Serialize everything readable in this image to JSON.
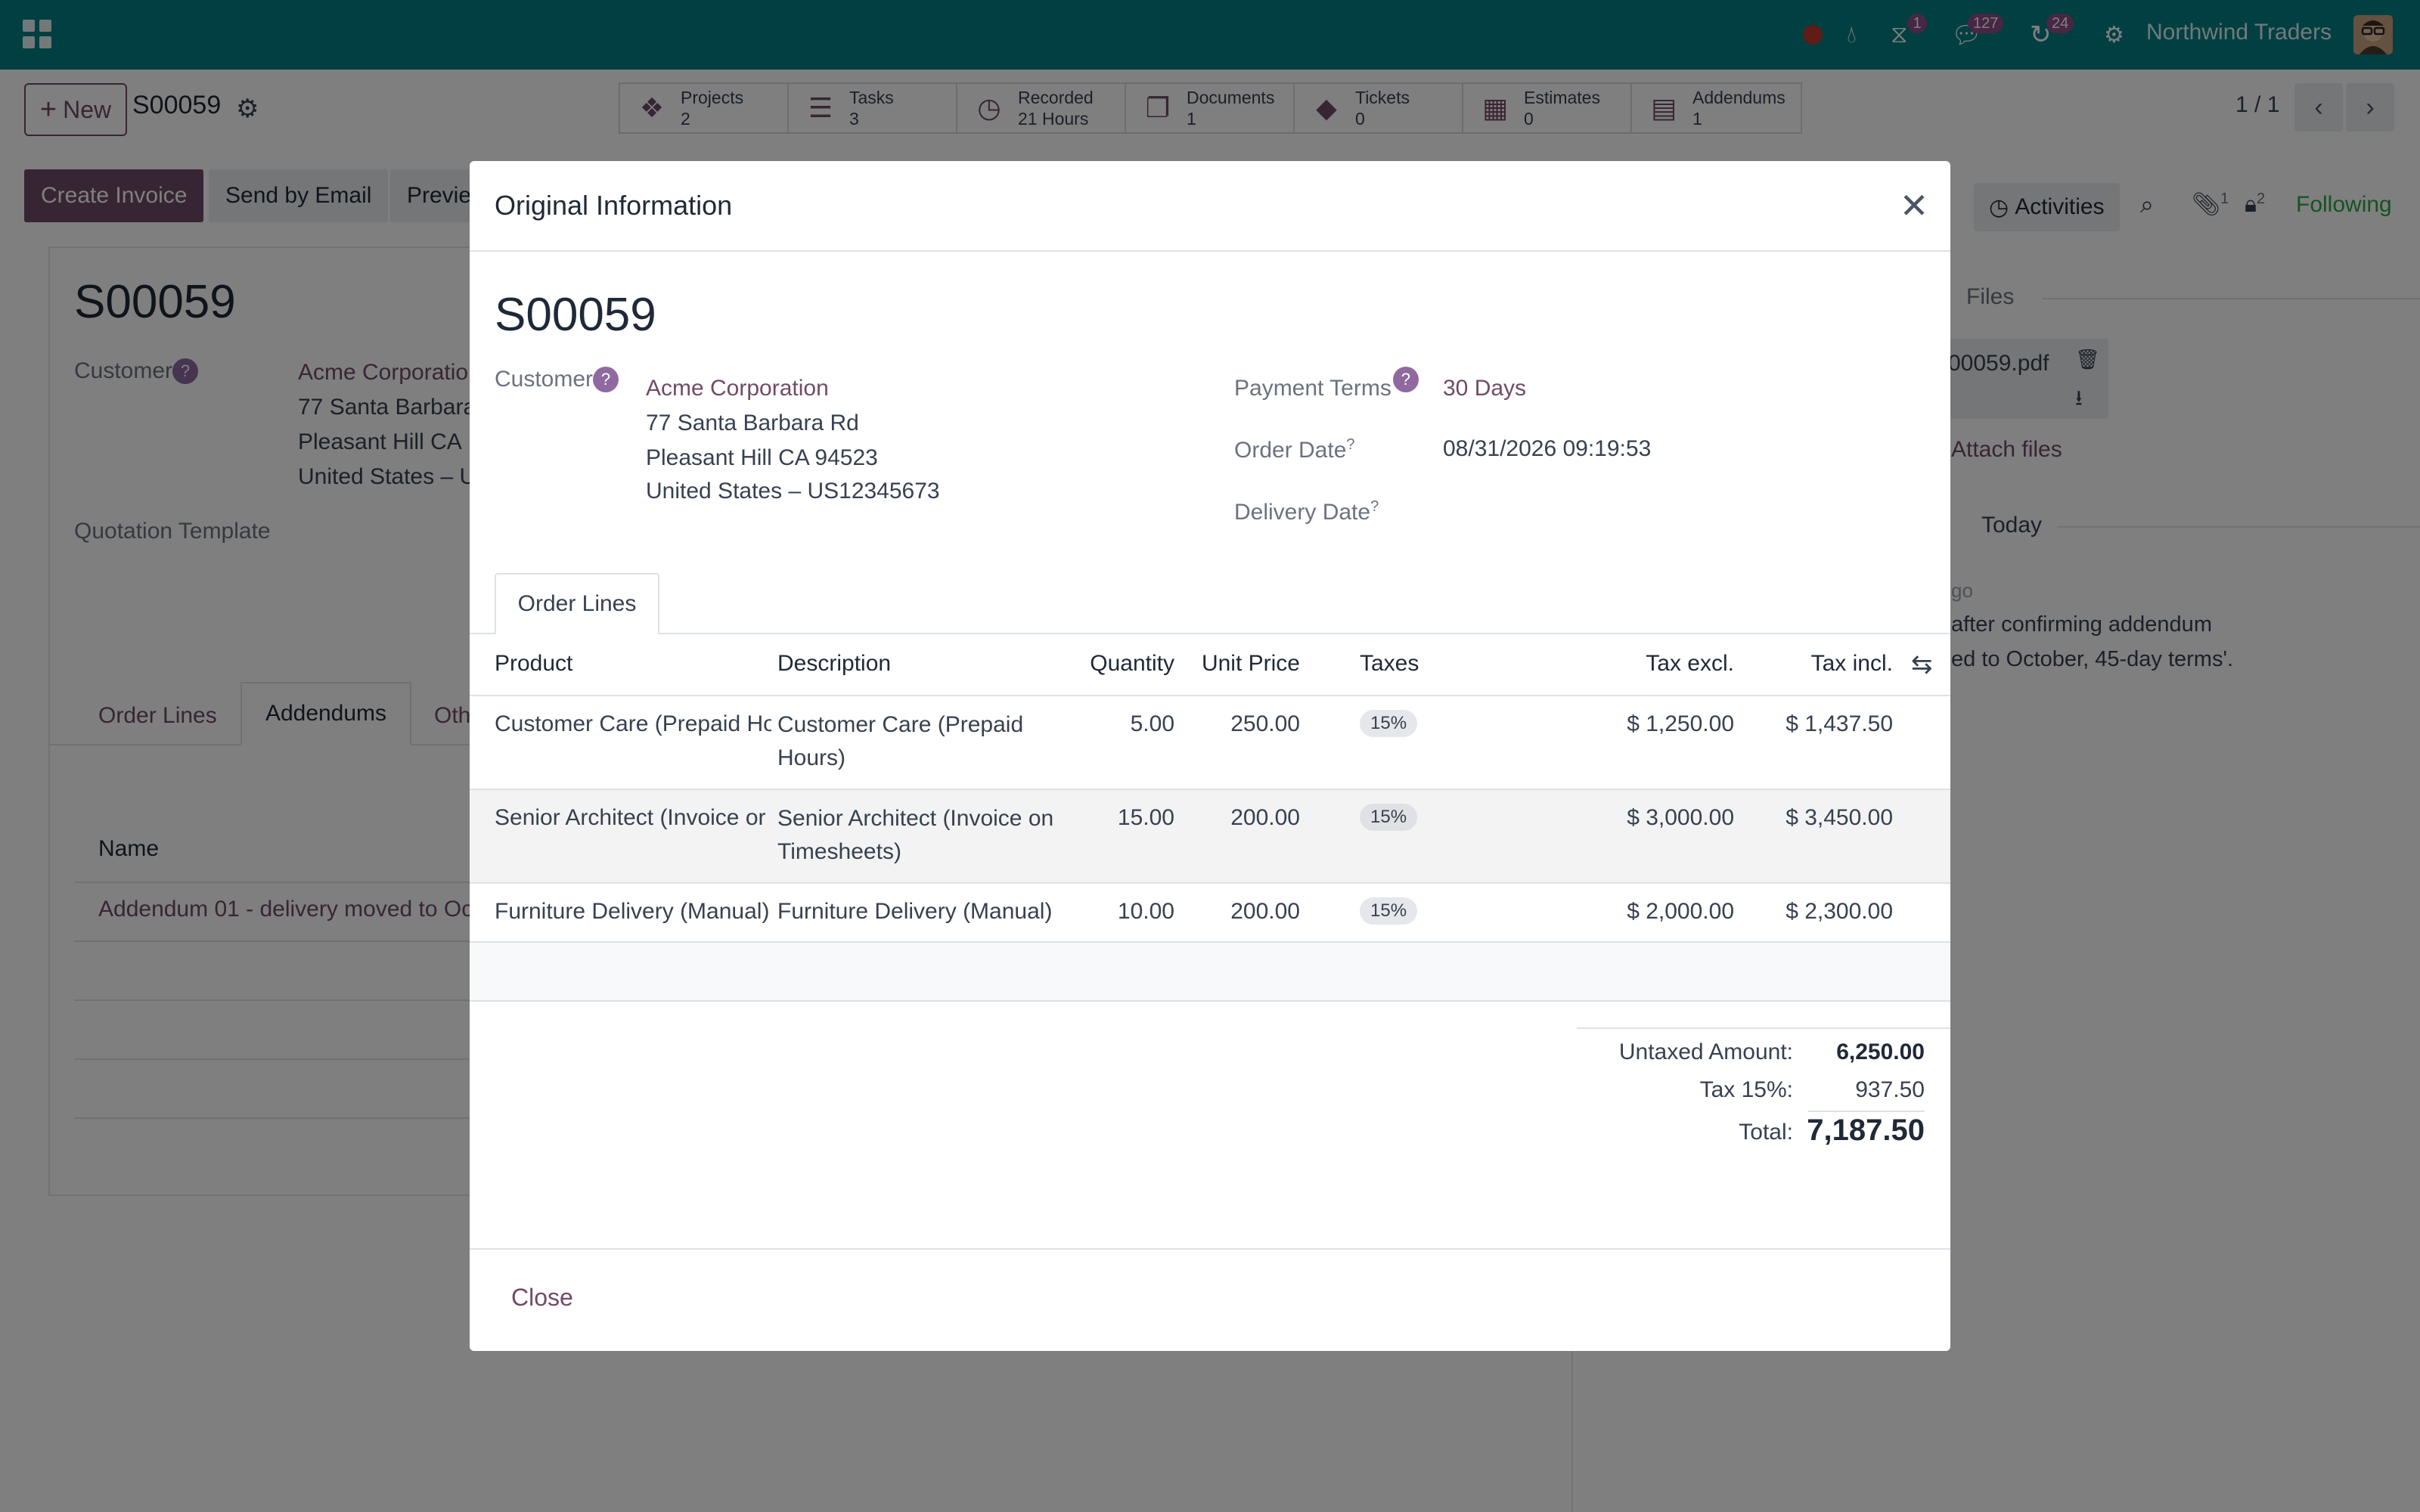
{
  "topbar": {
    "company": "Northwind Traders",
    "badges": {
      "activities": "1",
      "messages": "127",
      "updates": "24"
    }
  },
  "control": {
    "new_label": "New",
    "record": "S00059",
    "pager": "1 / 1",
    "smart_buttons": [
      {
        "label": "Projects",
        "value": "2",
        "icon": "puzzle-icon"
      },
      {
        "label": "Tasks",
        "value": "3",
        "icon": "tasks-icon"
      },
      {
        "label": "Recorded",
        "value": "21 Hours",
        "icon": "clock-icon"
      },
      {
        "label": "Documents",
        "value": "1",
        "icon": "documents-icon"
      },
      {
        "label": "Tickets",
        "value": "0",
        "icon": "ticket-icon"
      },
      {
        "label": "Estimates",
        "value": "0",
        "icon": "table-icon"
      },
      {
        "label": "Addendums",
        "value": "1",
        "icon": "book-icon"
      }
    ]
  },
  "actions": {
    "create_invoice": "Create Invoice",
    "send_email": "Send by Email",
    "preview": "Previe"
  },
  "form": {
    "name": "S00059",
    "customer_label": "Customer",
    "customer_name": "Acme Corporatio",
    "address1": "77 Santa Barbara",
    "address2": "Pleasant Hill CA",
    "address3": "United States – U",
    "quotation_template": "Quotation Template",
    "tabs": [
      "Order Lines",
      "Addendums",
      "Oth"
    ],
    "list_header": "Name",
    "addendum_row": "Addendum 01 - delivery moved to Oct"
  },
  "chatter": {
    "activities": "Activities",
    "following": "Following",
    "attach_count": "1",
    "follower_count": "2",
    "files_heading": "Files",
    "file_name": "00059.pdf",
    "attach_files": "Attach files",
    "today": "Today",
    "msg_time": "go",
    "msg_line1": "after confirming addendum",
    "msg_line2": "ed to October, 45-day terms'."
  },
  "modal": {
    "title": "Original Information",
    "so_name": "S00059",
    "customer_label": "Customer",
    "customer_name": "Acme Corporation",
    "address1": "77 Santa Barbara Rd",
    "address2": "Pleasant Hill CA 94523",
    "address3": "United States – US12345673",
    "payment_terms_label": "Payment Terms",
    "payment_terms": "30 Days",
    "order_date_label": "Order Date",
    "order_date": "08/31/2026 09:19:53",
    "delivery_date_label": "Delivery Date",
    "tab": "Order Lines",
    "columns": [
      "Product",
      "Description",
      "Quantity",
      "Unit Price",
      "Taxes",
      "Tax excl.",
      "Tax incl."
    ],
    "lines": [
      {
        "product": "Customer Care (Prepaid Ho",
        "description": "Customer Care (Prepaid Hours)",
        "quantity": "5.00",
        "unit_price": "250.00",
        "taxes": "15%",
        "tax_excl": "$ 1,250.00",
        "tax_incl": "$ 1,437.50"
      },
      {
        "product": "Senior Architect (Invoice or",
        "description": "Senior Architect (Invoice on Timesheets)",
        "quantity": "15.00",
        "unit_price": "200.00",
        "taxes": "15%",
        "tax_excl": "$ 3,000.00",
        "tax_incl": "$ 3,450.00"
      },
      {
        "product": "Furniture Delivery (Manual).",
        "description": "Furniture Delivery (Manual)",
        "quantity": "10.00",
        "unit_price": "200.00",
        "taxes": "15%",
        "tax_excl": "$ 2,000.00",
        "tax_incl": "$ 2,300.00"
      }
    ],
    "totals": {
      "untaxed_label": "Untaxed Amount:",
      "untaxed": "6,250.00",
      "tax_label": "Tax 15%:",
      "tax": "937.50",
      "total_label": "Total:",
      "total": "7,187.50"
    },
    "close": "Close"
  }
}
